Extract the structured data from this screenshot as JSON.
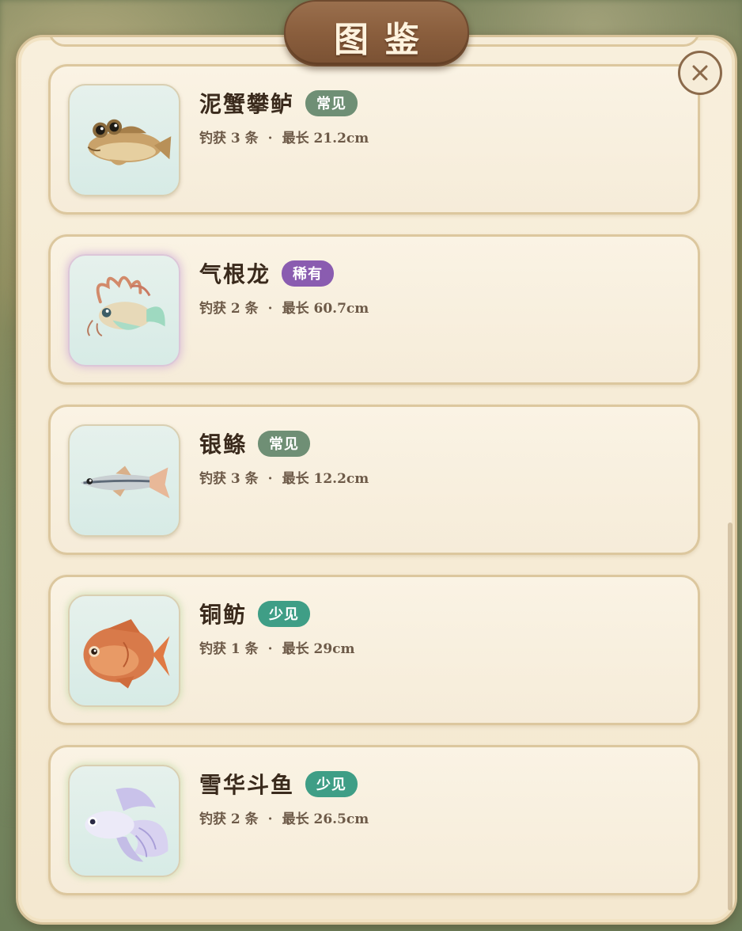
{
  "header": {
    "title": "图鉴"
  },
  "colors": {
    "common": "#6f8f75",
    "rare": "#8a5cb0",
    "uncommon": "#3f9e86"
  },
  "fish": [
    {
      "name": "泥蟹攀鲈",
      "rarity": "常见",
      "rarity_type": "common",
      "icon": "mudskipper-icon",
      "catch_label": "钓获 3 条",
      "sep": "·",
      "max_label": "最长 21.2cm"
    },
    {
      "name": "气根龙",
      "rarity": "稀有",
      "rarity_type": "rare",
      "icon": "dragon-fish-icon",
      "catch_label": "钓获 2 条",
      "sep": "·",
      "max_label": "最长 60.7cm"
    },
    {
      "name": "银鲦",
      "rarity": "常见",
      "rarity_type": "common",
      "icon": "silver-minnow-icon",
      "catch_label": "钓获 3 条",
      "sep": "·",
      "max_label": "最长 12.2cm"
    },
    {
      "name": "铜鲂",
      "rarity": "少见",
      "rarity_type": "uncommon",
      "icon": "copper-bream-icon",
      "catch_label": "钓获 1 条",
      "sep": "·",
      "max_label": "最长 29cm"
    },
    {
      "name": "雪华斗鱼",
      "rarity": "少见",
      "rarity_type": "uncommon",
      "icon": "betta-fish-icon",
      "catch_label": "钓获 2 条",
      "sep": "·",
      "max_label": "最长 26.5cm"
    }
  ]
}
